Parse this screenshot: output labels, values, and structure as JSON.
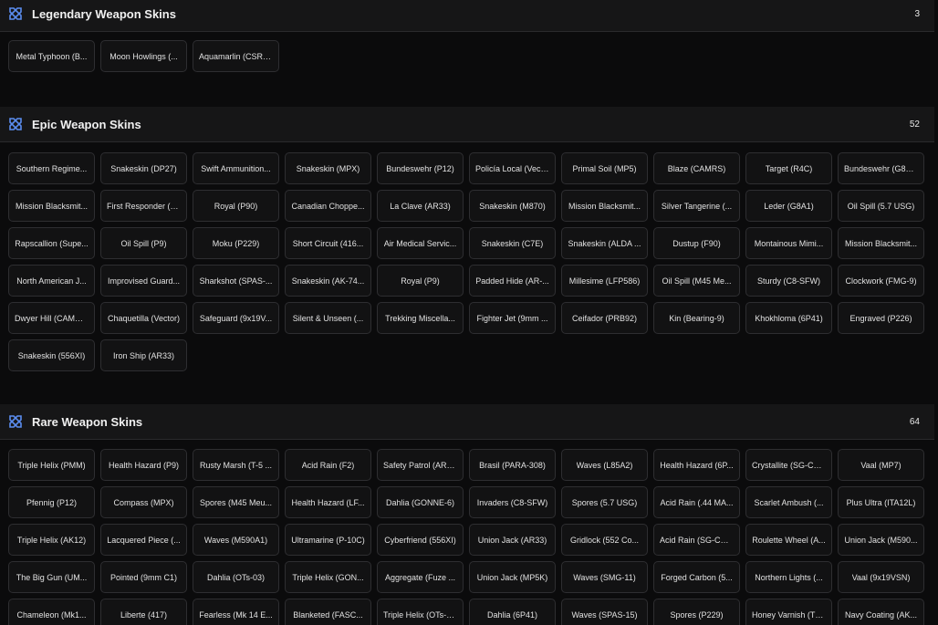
{
  "sections": [
    {
      "title": "Legendary Weapon Skins",
      "count": "3",
      "icon": "crossed-swords-icon",
      "items": [
        "Metal Typhoon (B...",
        "Moon Howlings (...",
        "Aquamarlin (CSRX..."
      ]
    },
    {
      "title": "Epic Weapon Skins",
      "count": "52",
      "icon": "crossed-swords-icon",
      "items": [
        "Southern Regime...",
        "Snakeskin (DP27)",
        "Swift Ammunition...",
        "Snakeskin (MPX)",
        "Bundeswehr (P12)",
        "Policía Local (Vect...",
        "Primal Soil (MP5)",
        "Blaze (CAMRS)",
        "Target (R4C)",
        "Bundeswehr (G8A1)",
        "Mission Blacksmit...",
        "First Responder (5...",
        "Royal (P90)",
        "Canadian Choppe...",
        "La Clave (AR33)",
        "Snakeskin (M870)",
        "Mission Blacksmit...",
        "Silver Tangerine (...",
        "Leder (G8A1)",
        "Oil Spill (5.7 USG)",
        "Rapscallion (Supe...",
        "Oil Spill (P9)",
        "Moku (P229)",
        "Short Circuit (416...",
        "Air Medical Servic...",
        "Snakeskin (C7E)",
        "Snakeskin (ALDA ...",
        "Dustup (F90)",
        "Montainous Mimi...",
        "Mission Blacksmit...",
        "North American J...",
        "Improvised Guard...",
        "Sharkshot (SPAS-...",
        "Snakeskin (AK-74...",
        "Royal (P9)",
        "Padded Hide (AR-...",
        "Millesime (LFP586)",
        "Oil Spill (M45 Me...",
        "Sturdy (C8-SFW)",
        "Clockwork (FMG-9)",
        "Dwyer Hill (CAMRS)",
        "Chaquetilla (Vector)",
        "Safeguard (9x19V...",
        "Silent & Unseen (...",
        "Trekking Miscella...",
        "Fighter Jet (9mm ...",
        "Ceifador (PRB92)",
        "Kin (Bearing-9)",
        "Khokhloma (6P41)",
        "Engraved (P226)",
        "Snakeskin (556XI)",
        "Iron Ship (AR33)"
      ]
    },
    {
      "title": "Rare Weapon Skins",
      "count": "64",
      "icon": "crossed-swords-icon",
      "items": [
        "Triple Helix (PMM)",
        "Health Hazard (P9)",
        "Rusty Marsh (T-5 ...",
        "Acid Rain (F2)",
        "Safety Patrol (AR33)",
        "Brasil (PARA-308)",
        "Waves (L85A2)",
        "Health Hazard (6P...",
        "Crystallite (SG-CQB)",
        "Vaal (MP7)",
        "Pfennig (P12)",
        "Compass (MPX)",
        "Spores (M45 Meu...",
        "Health Hazard (LF...",
        "Dahlia (GONNE-6)",
        "Invaders (C8-SFW)",
        "Spores (5.7 USG)",
        "Acid Rain (.44 MA...",
        "Scarlet Ambush (...",
        "Plus Ultra (ITA12L)",
        "Triple Helix (AK12)",
        "Lacquered Piece (...",
        "Waves (M590A1)",
        "Ultramarine (P-10C)",
        "Cyberfriend (556XI)",
        "Union Jack (AR33)",
        "Gridlock (552 Co...",
        "Acid Rain (SG-CQB)",
        "Roulette Wheel (A...",
        "Union Jack (M590...",
        "The Big Gun (UM...",
        "Pointed (9mm C1)",
        "Dahlia (OTs-03)",
        "Triple Helix (GON...",
        "Aggregate (Fuze ...",
        "Union Jack (MP5K)",
        "Waves (SMG-11)",
        "Forged Carbon (5...",
        "Northern Lights (...",
        "Vaal (9x19VSN)",
        "Chameleon (Mk1...",
        "Liberte (417)",
        "Fearless (Mk 14 E...",
        "Blanketed (FASC...",
        "Triple Helix (OTs-0...",
        "Dahlia (6P41)",
        "Waves (SPAS-15)",
        "Spores (P229)",
        "Honey Varnish (TC...",
        "Navy Coating (AK..."
      ]
    }
  ],
  "colors": {
    "accent_icon": "#5b8def",
    "background": "#0b0b0c",
    "header_bg": "#161617",
    "card_bg": "#121213",
    "card_border": "#2e2e31"
  }
}
